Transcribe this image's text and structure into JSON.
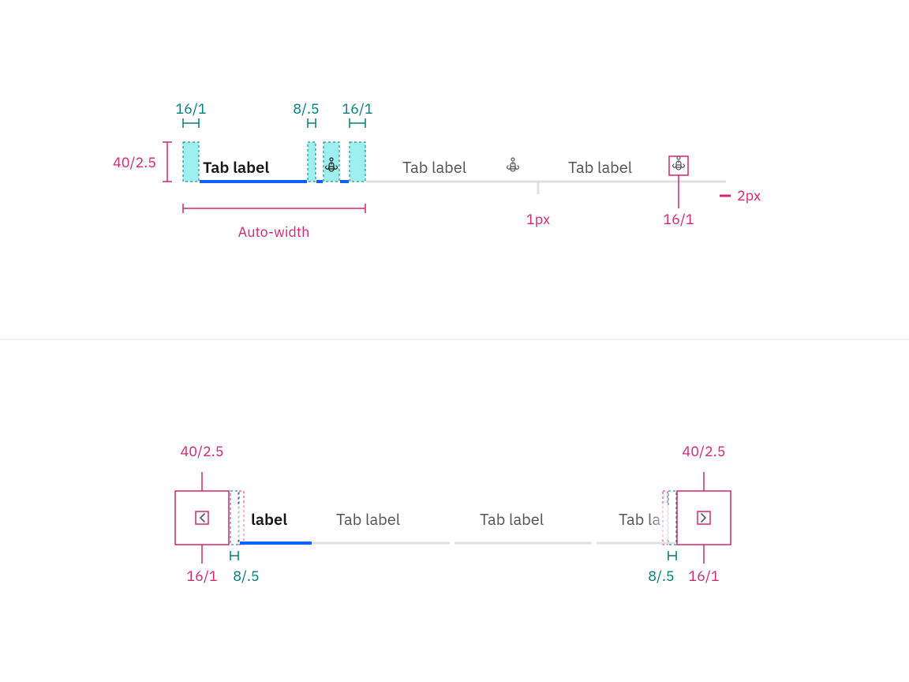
{
  "colors": {
    "teal": "#007d79",
    "tealHighlight": "#9ef0f0",
    "magenta": "#d12771",
    "blue": "#0f62fe",
    "trackGray": "#e0e0e0",
    "textGray": "#525252",
    "textBlack": "#161616"
  },
  "spec1": {
    "heightLabel": "40/2.5",
    "padLeftLabel": "16/1",
    "gapLabel": "8/.5",
    "padRightLabel": "16/1",
    "autoWidthLabel": "Auto-width",
    "dividerLabel": "1px",
    "iconSizeLabel": "16/1",
    "underlineLabel": "2px",
    "tabs": [
      {
        "label": "Tab label",
        "active": true
      },
      {
        "label": "Tab label",
        "active": false
      },
      {
        "label": "Tab label",
        "active": false
      }
    ]
  },
  "spec2": {
    "scrollBtnLabelLeft": "40/2.5",
    "scrollBtnLabelRight": "40/2.5",
    "iconSizeLeftLabel": "16/1",
    "iconSizeRightLabel": "16/1",
    "fadeGapLeftLabel": "8/.5",
    "fadeGapRightLabel": "8/.5",
    "tabs": [
      {
        "label": "label",
        "active": true
      },
      {
        "label": "Tab label",
        "active": false
      },
      {
        "label": "Tab label",
        "active": false
      },
      {
        "label": "Tab la",
        "active": false
      }
    ]
  }
}
